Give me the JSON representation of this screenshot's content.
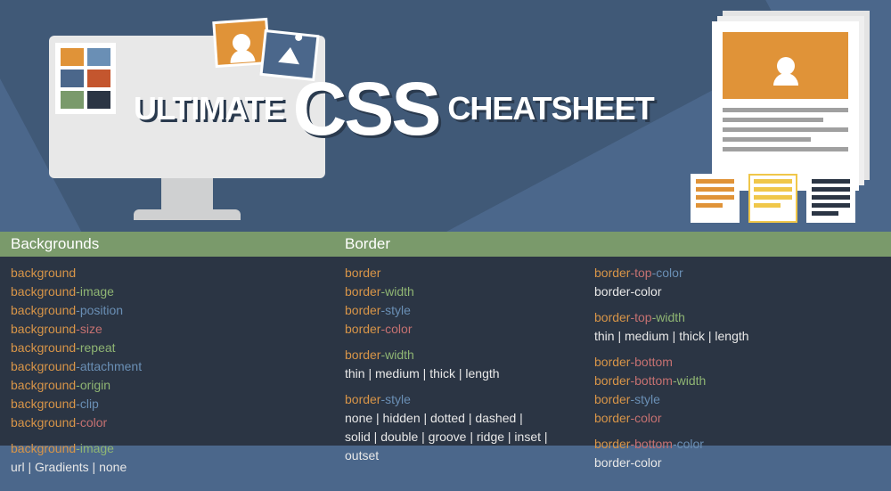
{
  "hero": {
    "title_1": "ULTIMATE",
    "title_2": "CSS",
    "title_3": "CHEATSHEET",
    "palette_colors": [
      "#e09338",
      "#6a8fb5",
      "#4b678b",
      "#c4562e",
      "#7a9a6b",
      "#2b3544"
    ]
  },
  "sections": {
    "backgrounds": {
      "header": "Backgrounds",
      "props": [
        [
          {
            "t": "background",
            "c": "o"
          }
        ],
        [
          {
            "t": "background",
            "c": "o"
          },
          {
            "t": "-image",
            "c": "g"
          }
        ],
        [
          {
            "t": "background",
            "c": "o"
          },
          {
            "t": "-position",
            "c": "b"
          }
        ],
        [
          {
            "t": "background",
            "c": "o"
          },
          {
            "t": "-size",
            "c": "r"
          }
        ],
        [
          {
            "t": "background",
            "c": "o"
          },
          {
            "t": "-repeat",
            "c": "g"
          }
        ],
        [
          {
            "t": "background",
            "c": "o"
          },
          {
            "t": "-attachment",
            "c": "b"
          }
        ],
        [
          {
            "t": "background",
            "c": "o"
          },
          {
            "t": "-origin",
            "c": "g"
          }
        ],
        [
          {
            "t": "background",
            "c": "o"
          },
          {
            "t": "-clip",
            "c": "b"
          }
        ],
        [
          {
            "t": "background",
            "c": "o"
          },
          {
            "t": "-color",
            "c": "r"
          }
        ]
      ],
      "extra_prop": [
        {
          "t": "background",
          "c": "o"
        },
        {
          "t": "-image",
          "c": "g"
        }
      ],
      "extra_val": "url | Gradients | none"
    },
    "border": {
      "header": "Border",
      "col1": {
        "g1": [
          [
            {
              "t": "border",
              "c": "o"
            }
          ],
          [
            {
              "t": "border",
              "c": "o"
            },
            {
              "t": "-width",
              "c": "g"
            }
          ],
          [
            {
              "t": "border",
              "c": "o"
            },
            {
              "t": "-style",
              "c": "b"
            }
          ],
          [
            {
              "t": "border",
              "c": "o"
            },
            {
              "t": "-color",
              "c": "r"
            }
          ]
        ],
        "g2_prop": [
          {
            "t": "border",
            "c": "o"
          },
          {
            "t": "-width",
            "c": "g"
          }
        ],
        "g2_val": "thin | medium | thick | length",
        "g3_prop": [
          {
            "t": "border",
            "c": "o"
          },
          {
            "t": "-style",
            "c": "b"
          }
        ],
        "g3_val": "none | hidden | dotted | dashed | solid | double | groove | ridge | inset | outset"
      },
      "col2": {
        "g1_prop": [
          {
            "t": "border",
            "c": "o"
          },
          {
            "t": "-top",
            "c": "r"
          },
          {
            "t": "-color",
            "c": "b"
          }
        ],
        "g1_val": "border-color",
        "g2_prop": [
          {
            "t": "border",
            "c": "o"
          },
          {
            "t": "-top",
            "c": "r"
          },
          {
            "t": "-width",
            "c": "g"
          }
        ],
        "g2_val": "thin | medium | thick | length",
        "g3": [
          [
            {
              "t": "border",
              "c": "o"
            },
            {
              "t": "-bottom",
              "c": "r"
            }
          ],
          [
            {
              "t": "border",
              "c": "o"
            },
            {
              "t": "-bottom",
              "c": "r"
            },
            {
              "t": "-width",
              "c": "g"
            }
          ],
          [
            {
              "t": "border",
              "c": "o"
            },
            {
              "t": "-style",
              "c": "b"
            }
          ],
          [
            {
              "t": "border",
              "c": "o"
            },
            {
              "t": "-color",
              "c": "r"
            }
          ]
        ],
        "g4_prop": [
          {
            "t": "border",
            "c": "o"
          },
          {
            "t": "-bottom",
            "c": "r"
          },
          {
            "t": "-color",
            "c": "b"
          }
        ],
        "g4_val": "border-color"
      }
    }
  }
}
